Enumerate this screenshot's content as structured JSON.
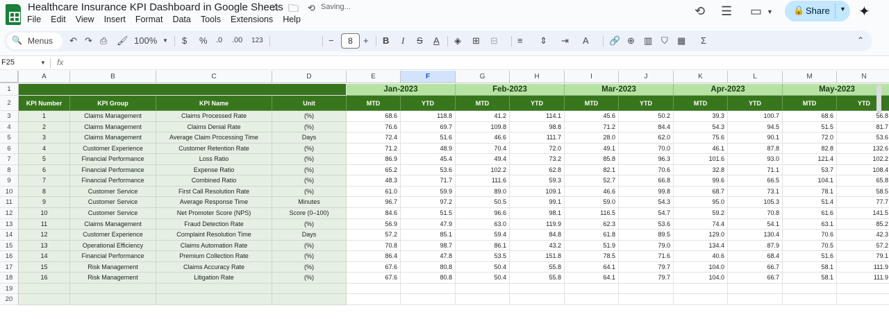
{
  "window": {
    "title": "Healthcare Insurance KPI Dashboard in Google Sheets",
    "status": "Saving...",
    "share_label": "Share"
  },
  "menu": [
    "File",
    "Edit",
    "View",
    "Insert",
    "Format",
    "Data",
    "Tools",
    "Extensions",
    "Help"
  ],
  "toolbar": {
    "menus_label": "Menus",
    "zoom": "100%",
    "currency": "$",
    "percent": "%",
    "decimal_decrease": ".0",
    "decimal_increase": ".00",
    "number_format": "123",
    "font_size": "8",
    "bold": "B",
    "italic": "I"
  },
  "formula_bar": {
    "cell_ref": "F25",
    "fx": "fx",
    "value": ""
  },
  "sheet": {
    "columns": [
      "A",
      "B",
      "C",
      "D",
      "E",
      "F",
      "G",
      "H",
      "I",
      "J",
      "K",
      "L",
      "M",
      "N"
    ],
    "selected_column": "F",
    "row_numbers": [
      "1",
      "2",
      "3",
      "4",
      "5",
      "6",
      "7",
      "8",
      "9",
      "10",
      "11",
      "12",
      "13",
      "14",
      "15",
      "16",
      "17",
      "18",
      "19",
      "20"
    ],
    "months": [
      "Jan-2023",
      "Feb-2023",
      "Mar-2023",
      "Apr-2023",
      "May-2023"
    ],
    "headers": [
      "KPI Number",
      "KPI Group",
      "KPI Name",
      "Unit"
    ],
    "sub_headers": [
      "MTD",
      "YTD"
    ],
    "rows": [
      [
        "1",
        "Claims Management",
        "Claims Processed Rate",
        "(%)",
        "68.6",
        "118.8",
        "41.2",
        "114.1",
        "45.6",
        "50.2",
        "39.3",
        "100.7",
        "68.6",
        "56.8"
      ],
      [
        "2",
        "Claims Management",
        "Claims Denial Rate",
        "(%)",
        "76.6",
        "69.7",
        "109.8",
        "98.8",
        "71.2",
        "84.4",
        "54.3",
        "94.5",
        "51.5",
        "81.7"
      ],
      [
        "3",
        "Claims Management",
        "Average Claim Processing Time",
        "Days",
        "72.4",
        "51.6",
        "46.6",
        "111.7",
        "28.0",
        "62.0",
        "75.6",
        "90.1",
        "72.0",
        "53.6"
      ],
      [
        "4",
        "Customer Experience",
        "Customer Retention Rate",
        "(%)",
        "71.2",
        "48.9",
        "70.4",
        "72.0",
        "49.1",
        "70.0",
        "46.1",
        "87.8",
        "82.8",
        "132.6"
      ],
      [
        "5",
        "Financial Performance",
        "Loss Ratio",
        "(%)",
        "86.9",
        "45.4",
        "49.4",
        "73.2",
        "85.8",
        "96.3",
        "101.6",
        "93.0",
        "121.4",
        "102.2"
      ],
      [
        "6",
        "Financial Performance",
        "Expense Ratio",
        "(%)",
        "65.2",
        "53.6",
        "102.2",
        "62.8",
        "82.1",
        "70.6",
        "32.8",
        "71.1",
        "53.7",
        "108.4"
      ],
      [
        "7",
        "Financial Performance",
        "Combined Ratio",
        "(%)",
        "48.3",
        "71.7",
        "111.6",
        "59.3",
        "52.7",
        "66.8",
        "99.6",
        "66.5",
        "104.1",
        "65.8"
      ],
      [
        "8",
        "Customer Service",
        "First Call Resolution Rate",
        "(%)",
        "61.0",
        "59.9",
        "89.0",
        "109.1",
        "46.6",
        "99.8",
        "68.7",
        "73.1",
        "78.1",
        "58.5"
      ],
      [
        "9",
        "Customer Service",
        "Average Response Time",
        "Minutes",
        "96.7",
        "97.2",
        "50.5",
        "99.1",
        "59.0",
        "54.3",
        "95.0",
        "105.3",
        "51.4",
        "77.7"
      ],
      [
        "10",
        "Customer Service",
        "Net Promoter Score (NPS)",
        "Score (0–100)",
        "84.6",
        "51.5",
        "96.6",
        "98.1",
        "116.5",
        "54.7",
        "59.2",
        "70.8",
        "61.6",
        "141.5"
      ],
      [
        "11",
        "Claims Management",
        "Fraud Detection Rate",
        "(%)",
        "56.9",
        "47.9",
        "63.0",
        "119.9",
        "62.3",
        "53.6",
        "74.4",
        "54.1",
        "63.1",
        "85.2"
      ],
      [
        "12",
        "Customer Experience",
        "Complaint Resolution Time",
        "Days",
        "57.2",
        "85.1",
        "59.4",
        "84.8",
        "61.8",
        "89.5",
        "129.0",
        "130.4",
        "70.6",
        "42.3"
      ],
      [
        "13",
        "Operational Efficiency",
        "Claims Automation Rate",
        "(%)",
        "70.8",
        "98.7",
        "86.1",
        "43.2",
        "51.9",
        "79.0",
        "134.4",
        "87.9",
        "70.5",
        "57.2"
      ],
      [
        "14",
        "Financial Performance",
        "Premium Collection Rate",
        "(%)",
        "86.4",
        "47.8",
        "53.5",
        "151.8",
        "78.5",
        "71.6",
        "40.6",
        "68.4",
        "51.6",
        "79.1"
      ],
      [
        "15",
        "Risk Management",
        "Claims Accuracy Rate",
        "(%)",
        "67.6",
        "80.8",
        "50.4",
        "55.8",
        "64.1",
        "79.7",
        "104.0",
        "66.7",
        "58.1",
        "111.9"
      ],
      [
        "16",
        "Risk Management",
        "Litigation Rate",
        "(%)",
        "67.6",
        "80.8",
        "50.4",
        "55.8",
        "64.1",
        "79.7",
        "104.0",
        "66.7",
        "58.1",
        "111.9"
      ]
    ]
  },
  "colors": {
    "header_dark_green": "#38761d",
    "month_light_green": "#b6e3a4",
    "left_block_fill": "#e6efe3",
    "share_button": "#c2e7ff"
  }
}
